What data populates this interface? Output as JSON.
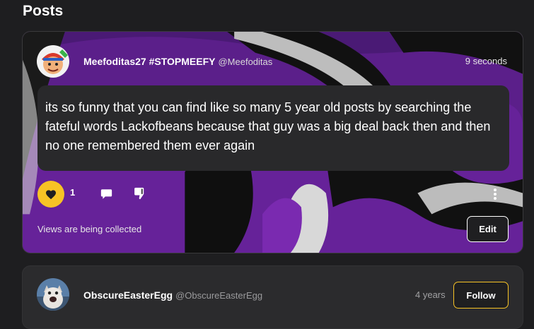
{
  "section": {
    "title": "Posts"
  },
  "posts": [
    {
      "author_name": "Meefoditas27 #STOPMEEFY",
      "author_handle": "@Meefoditas",
      "time": "9 seconds",
      "body": "its so funny that you can find like so many 5 year old posts by searching the fateful words Lackofbeans because that guy was a big deal back then and then no one remembered them ever again",
      "like_count": "1",
      "liked": true,
      "views_text": "Views are being collected",
      "edit_label": "Edit"
    },
    {
      "author_name": "ObscureEasterEgg",
      "author_handle": "@ObscureEasterEgg",
      "time": "4 years",
      "follow_label": "Follow"
    }
  ],
  "colors": {
    "accent": "#f7c325",
    "background": "#1e1e20",
    "card": "#2b2b2d",
    "banner_purple": "#5b1f8a",
    "banner_gray": "#a3a3a3"
  },
  "icons": {
    "like": "heart-icon",
    "comment": "comment-bubble-icon",
    "dislike": "thumbs-down-icon",
    "more": "vertical-ellipsis-icon"
  }
}
